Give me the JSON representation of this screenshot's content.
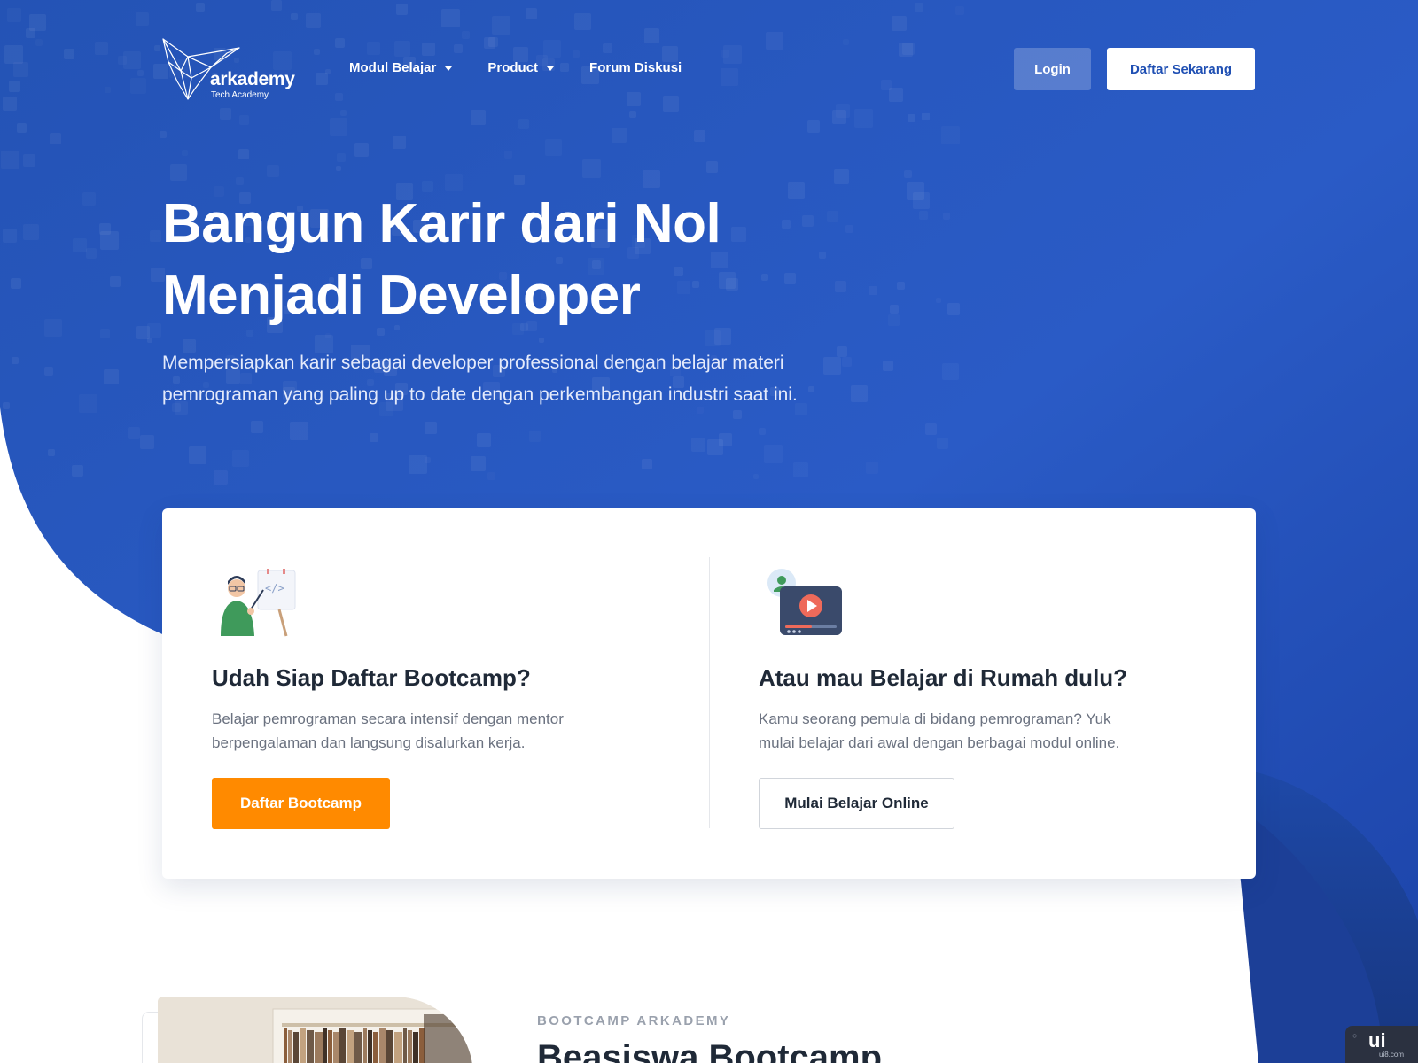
{
  "brand": {
    "name": "arkademy",
    "tagline": "Tech Academy"
  },
  "nav": {
    "items": [
      {
        "label": "Modul Belajar",
        "dropdown": true
      },
      {
        "label": "Product",
        "dropdown": true
      },
      {
        "label": "Forum Diskusi",
        "dropdown": false
      }
    ]
  },
  "header": {
    "login_label": "Login",
    "register_label": "Daftar Sekarang"
  },
  "hero": {
    "title_line1": "Bangun Karir dari Nol",
    "title_line2": "Menjadi Developer",
    "subtitle_line1": "Mempersiapkan karir sebagai developer professional dengan belajar materi",
    "subtitle_line2": "pemrograman yang paling up to date dengan perkembangan industri saat ini."
  },
  "cards": {
    "bootcamp": {
      "icon": "teacher-illustration-icon",
      "title": "Udah Siap Daftar Bootcamp?",
      "desc_line1": "Belajar pemrograman secara intensif dengan mentor",
      "desc_line2": "berpengalaman dan langsung disalurkan kerja.",
      "button": "Daftar Bootcamp"
    },
    "online": {
      "icon": "video-course-illustration-icon",
      "title": "Atau mau Belajar di Rumah dulu?",
      "desc_line1": "Kamu seorang pemula di bidang pemrograman? Yuk",
      "desc_line2": "mulai belajar dari awal dengan berbagai modul online.",
      "button": "Mulai Belajar Online"
    }
  },
  "section": {
    "eyebrow": "BOOTCAMP ARKADEMY",
    "title": "Beasiswa Bootcamp"
  },
  "watermark": {
    "main": "ui",
    "sub": "ui8.com"
  },
  "colors": {
    "hero_blue": "#2450b8",
    "hero_blue_dark": "#1a3c9c",
    "wave_navy": "#1b3a8a",
    "accent_orange": "#ff8a00",
    "brand_button_text": "#1f4fb3"
  }
}
